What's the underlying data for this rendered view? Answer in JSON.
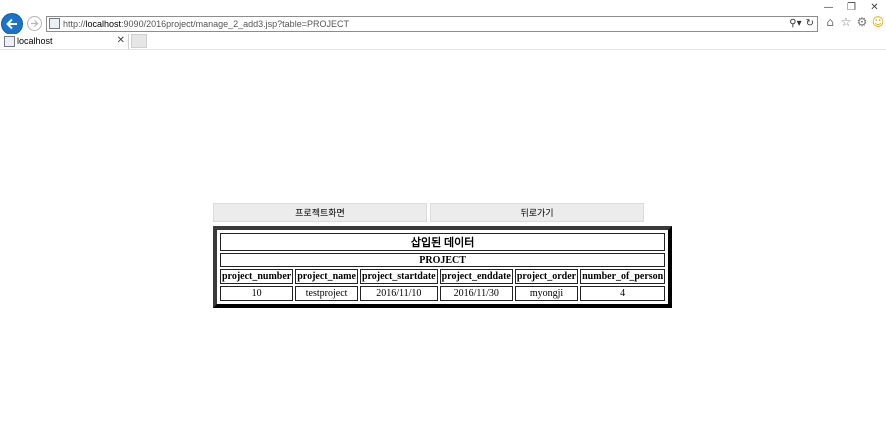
{
  "browser": {
    "url_prefix": "http://",
    "url_host": "localhost",
    "url_rest": ":9090/2016project/manage_2_add3.jsp?table=PROJECT",
    "tab_title": "localhost"
  },
  "page": {
    "buttons": {
      "project_screen": "프로젝트화면",
      "back": "뒤로가기"
    },
    "table": {
      "caption": "삽입된 데이터",
      "name": "PROJECT",
      "headers": [
        "project_number",
        "project_name",
        "project_startdate",
        "project_enddate",
        "project_order",
        "number_of_person"
      ],
      "rows": [
        [
          "10",
          "testproject",
          "2016/11/10",
          "2016/11/30",
          "myongji",
          "4"
        ]
      ]
    }
  },
  "icons": {
    "back": "back-arrow-icon",
    "forward": "forward-arrow-icon",
    "home": "home-icon",
    "favorites": "star-icon",
    "settings": "gear-icon",
    "feedback": "smiley-icon"
  },
  "colors": {
    "back_button": "#1a73c9",
    "table_border": "#2b2b2b",
    "button_bg": "#ececec"
  }
}
